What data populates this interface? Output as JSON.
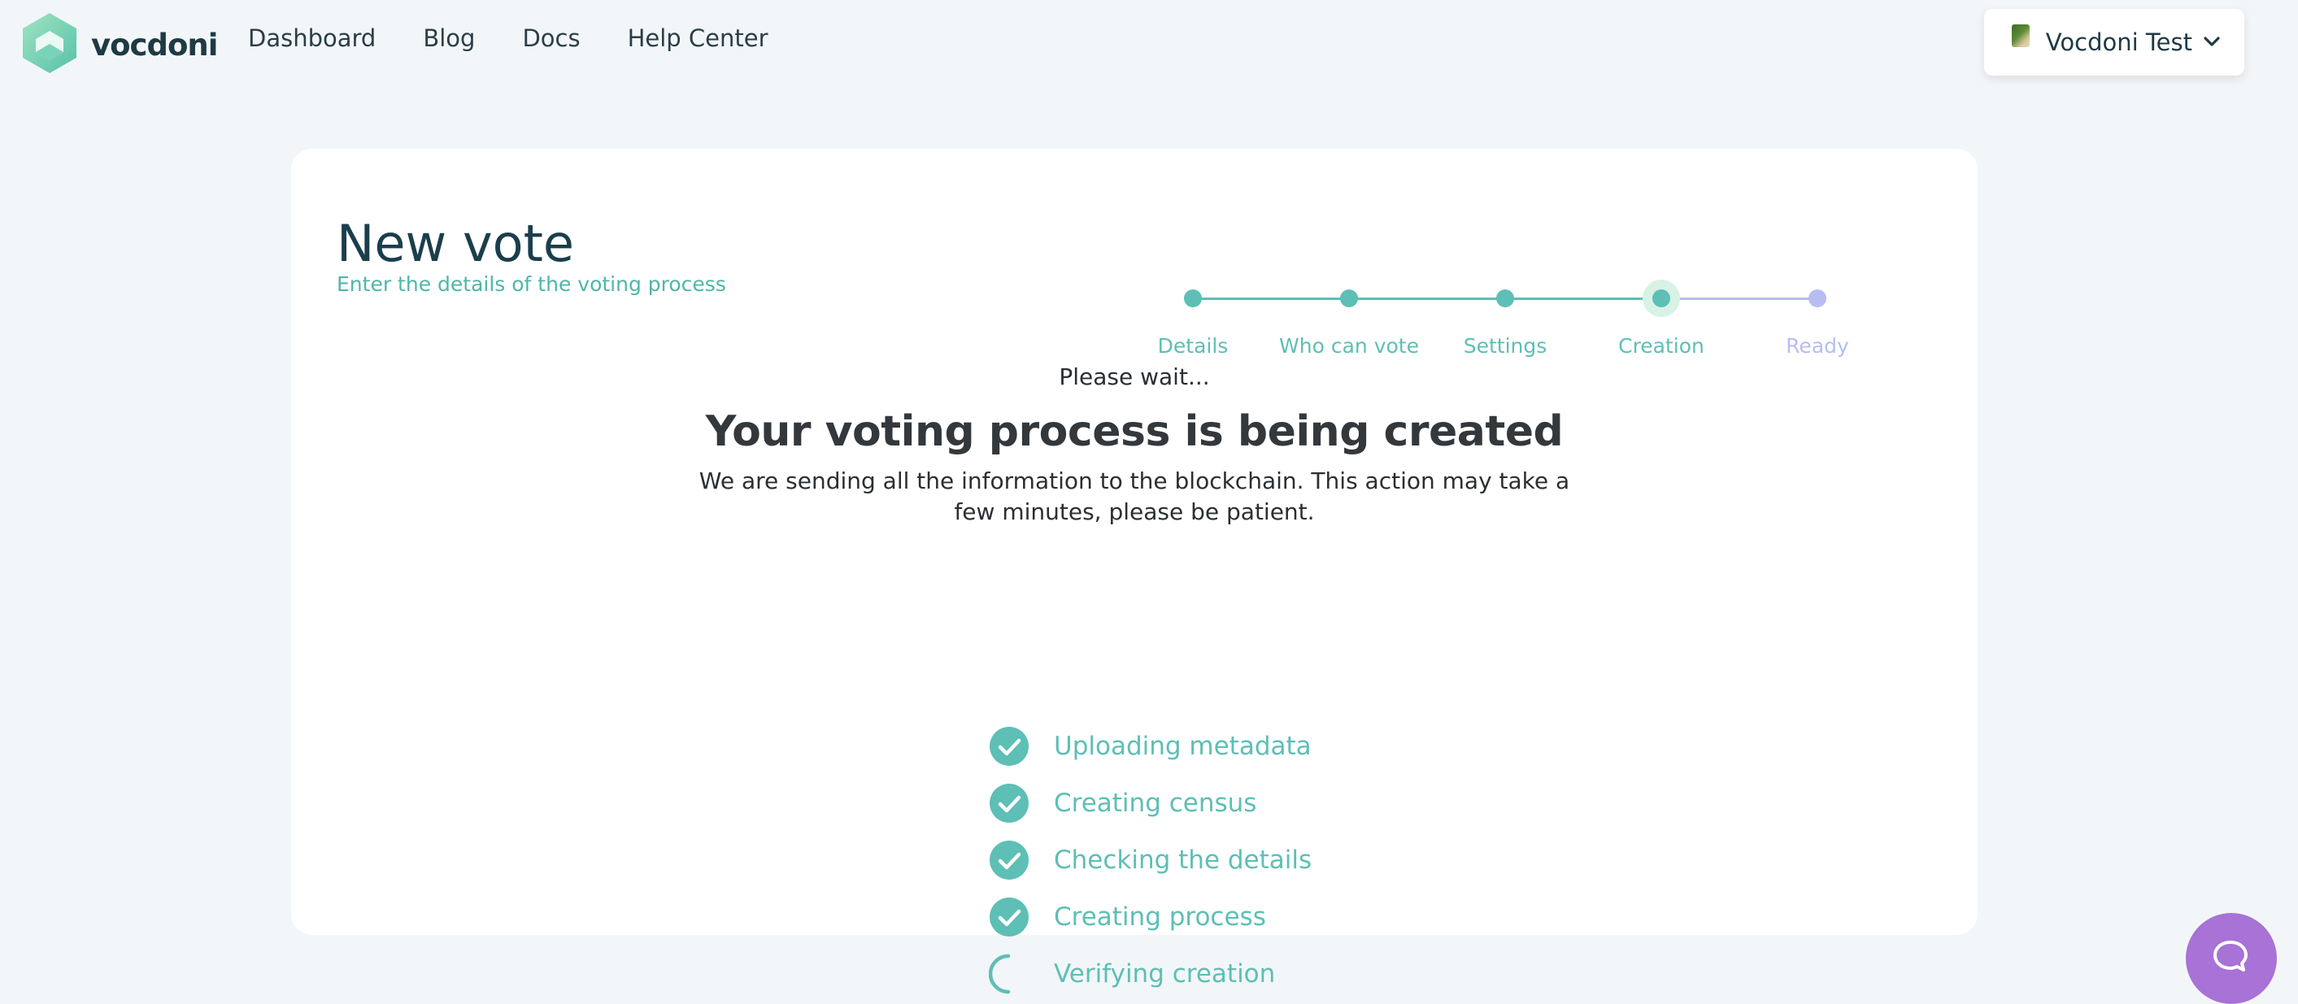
{
  "header": {
    "logo_text": "vocdoni",
    "nav": [
      "Dashboard",
      "Blog",
      "Docs",
      "Help Center"
    ],
    "account_name": "Vocdoni Test"
  },
  "card": {
    "title": "New vote",
    "subtitle": "Enter the details of the voting process",
    "steps": [
      "Details",
      "Who can vote",
      "Settings",
      "Creation",
      "Ready"
    ],
    "current_step": "Creation",
    "wait": "Please wait...",
    "headline": "Your voting process is being created",
    "description": "We are sending all the information to the blockchain. This action may take a few minutes, please be patient.",
    "tasks": [
      {
        "label": "Uploading metadata",
        "status": "done"
      },
      {
        "label": "Creating census",
        "status": "done"
      },
      {
        "label": "Checking the details",
        "status": "done"
      },
      {
        "label": "Creating process",
        "status": "done"
      },
      {
        "label": "Verifying creation",
        "status": "in-progress"
      }
    ]
  },
  "colors": {
    "accent": "#4fb6ab",
    "step_done": "#5dbfb5",
    "step_pending": "#b7bdf0",
    "chat": "#a872d6"
  },
  "icons": {
    "logo": "vocdoni-logo-icon",
    "account_menu": "chevron-down-icon",
    "task_done": "check-circle-icon",
    "task_progress": "spinner-icon",
    "chat": "chat-bubble-icon"
  }
}
